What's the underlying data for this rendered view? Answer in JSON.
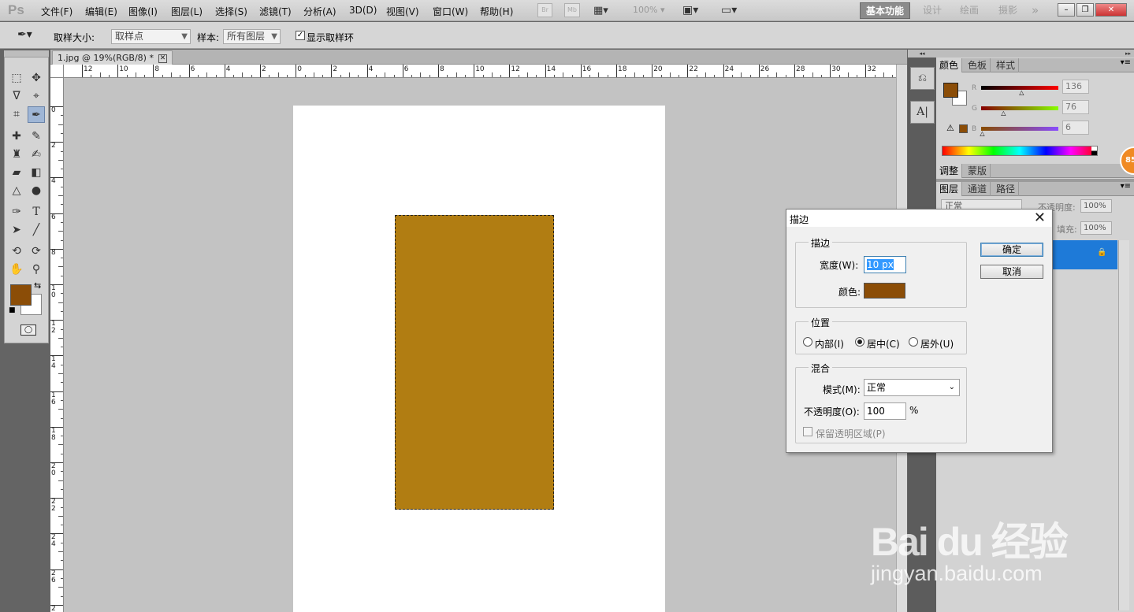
{
  "app": {
    "logo": "Ps"
  },
  "menu": [
    "文件(F)",
    "编辑(E)",
    "图像(I)",
    "图层(L)",
    "选择(S)",
    "滤镜(T)",
    "分析(A)",
    "3D(D)",
    "视图(V)",
    "窗口(W)",
    "帮助(H)"
  ],
  "menubar_tools": {
    "br": "Br",
    "mb": "Mb",
    "zoom": "100%"
  },
  "workspaces": [
    "基本功能",
    "设计",
    "绘画",
    "摄影"
  ],
  "workspace_more": "»",
  "options": {
    "sample_size_label": "取样大小:",
    "sample_size_value": "取样点",
    "sample_label": "样本:",
    "sample_value": "所有图层",
    "show_ring_label": "显示取样环"
  },
  "document": {
    "tab_title": "1.jpg @ 19%(RGB/8) *",
    "close": "✕"
  },
  "rulers": {
    "top": [
      "12",
      "10",
      "8",
      "6",
      "4",
      "2",
      "0",
      "2",
      "4",
      "6",
      "8",
      "10",
      "12",
      "14",
      "16",
      "18",
      "20",
      "22",
      "24",
      "26",
      "28",
      "30",
      "32"
    ],
    "left": [
      "0",
      "2",
      "4",
      "6",
      "8",
      "10",
      "12",
      "14",
      "16",
      "18",
      "20",
      "22",
      "24",
      "26",
      "28"
    ]
  },
  "colors": {
    "foreground": "#8b4d07",
    "background": "#ffffff",
    "selection_fill": "#b17d12",
    "stroke_color": "#8b4d07",
    "accent_blue": "#1e7ad8"
  },
  "color_panel": {
    "tabs": [
      "颜色",
      "色板",
      "样式"
    ],
    "channels": [
      {
        "name": "R",
        "value": "136",
        "fraction": 0.533
      },
      {
        "name": "G",
        "value": "76",
        "fraction": 0.298
      },
      {
        "name": "B",
        "value": "6",
        "fraction": 0.024
      }
    ]
  },
  "adjust_panel": {
    "tabs": [
      "调整",
      "蒙版"
    ]
  },
  "layers_panel": {
    "tabs": [
      "图层",
      "通道",
      "路径"
    ],
    "blend_mode": "正常",
    "opacity_label": "不透明度:",
    "opacity_value": "100%",
    "fill_label": "填充:",
    "fill_value": "100%"
  },
  "badge": "85",
  "dialog": {
    "title": "描边",
    "close": "✕",
    "stroke_group": "描边",
    "width_label": "宽度(W):",
    "width_value": "10 px",
    "color_label": "颜色:",
    "position_group": "位置",
    "positions": [
      "内部(I)",
      "居中(C)",
      "居外(U)"
    ],
    "selected_position": "居中(C)",
    "blend_group": "混合",
    "mode_label": "模式(M):",
    "mode_value": "正常",
    "opacity_label": "不透明度(O):",
    "opacity_value": "100",
    "percent": "%",
    "preserve_label": "保留透明区域(P)",
    "ok": "确定",
    "cancel": "取消"
  },
  "watermark": {
    "brand": "Bai du 经验",
    "url": "jingyan.baidu.com"
  }
}
